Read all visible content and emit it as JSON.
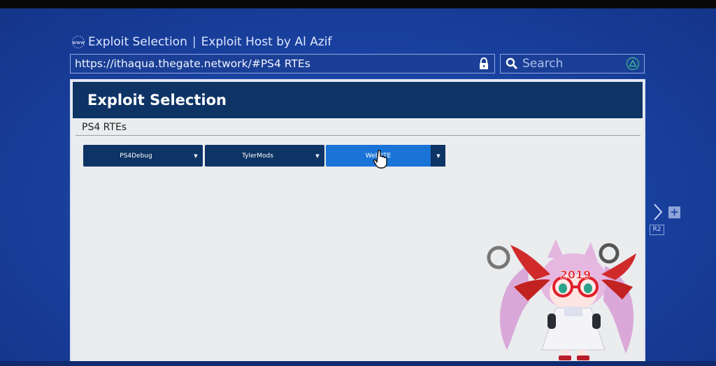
{
  "browser": {
    "page_title": "Exploit Selection",
    "title_separator": "|",
    "site_title": "Exploit Host by Al Azif",
    "url": "https://ithaqua.thegate.network/#PS4 RTEs",
    "search_placeholder": "Search"
  },
  "page": {
    "header": "Exploit Selection",
    "section": "PS4 RTEs",
    "buttons": [
      {
        "label": "PS4Debug"
      },
      {
        "label": "TylerMods"
      },
      {
        "label": "WebRTE"
      }
    ]
  },
  "controls": {
    "r2_label": "R2",
    "plus_glyph": "+"
  },
  "mascot": {
    "glasses_text": "2019"
  },
  "colors": {
    "background": "#1a43a3",
    "header": "#0e3466",
    "active_button": "#1a74d8",
    "page_bg": "#eaecee"
  }
}
